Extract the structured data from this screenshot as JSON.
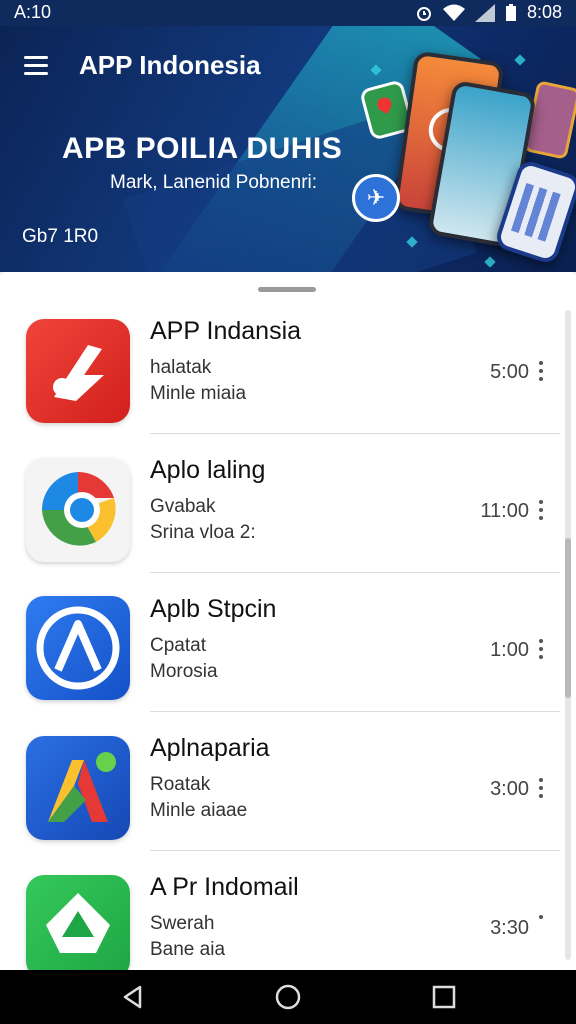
{
  "status_bar": {
    "time_left": "A:10",
    "time_right": "8:08",
    "icons": [
      "alarm-icon",
      "wifi-icon",
      "signal-icon",
      "battery-icon"
    ]
  },
  "header": {
    "title": "APP Indonesia",
    "headline": "APB POILIA DUHIS",
    "subhead": "Mark, Lanenid Pobnenri:",
    "meta": "Gb7 1R0",
    "colors": {
      "background": "#0f2a5c",
      "accent": "#2fd3e3"
    }
  },
  "apps": [
    {
      "name": "APP Indansia",
      "line1": "halatak",
      "line2": "Minle miaia",
      "time": "5:00",
      "icon": "red-play-app-icon",
      "color": "#e53935"
    },
    {
      "name": "Aplo laling",
      "line1": "Gvabak",
      "line2": "Srina vloa  2:",
      "time": "11:00",
      "icon": "chrome-style-app-icon",
      "color": "#f0f0f0"
    },
    {
      "name": "Aplb Stpcin",
      "line1": "Cpatat",
      "line2": "Morosia",
      "time": "1:00",
      "icon": "blue-a-app-icon",
      "color": "#1e63e0"
    },
    {
      "name": "Aplnaparia",
      "line1": "Roatak",
      "line2": "Minle aiaae",
      "time": "3:00",
      "icon": "colorful-a-app-icon",
      "color": "#1f5fd0"
    },
    {
      "name": "A Pr Indomail",
      "line1": "Swerah",
      "line2": "Bane aia",
      "time": "3:30",
      "icon": "green-triangle-app-icon",
      "color": "#25b84a"
    }
  ],
  "nav": {
    "buttons": [
      "back-icon",
      "home-icon",
      "recents-icon"
    ]
  }
}
